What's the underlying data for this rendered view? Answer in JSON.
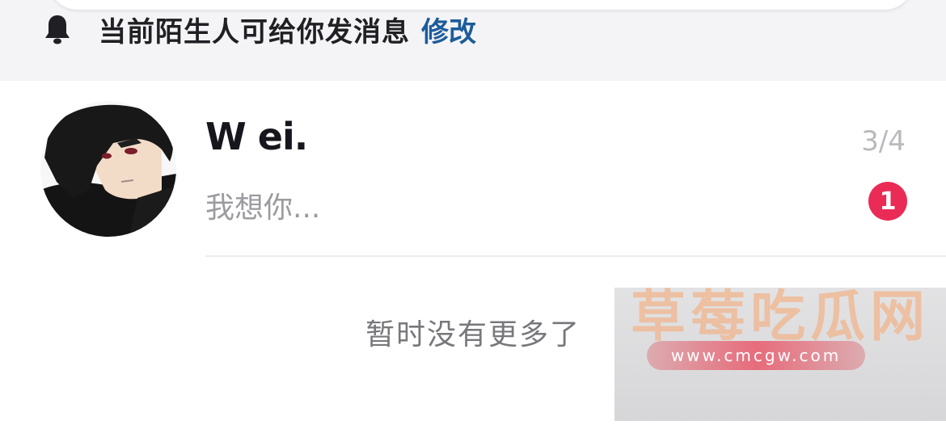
{
  "notice": {
    "icon": "bell-icon",
    "text": "当前陌生人可给你发消息",
    "action_label": "修改",
    "action_color": "#1d5c9b"
  },
  "conversation": {
    "avatar_icon": "anime-avatar",
    "name": "W ei.",
    "count": "3/4",
    "preview": "我想你...",
    "unread_badge": "1",
    "badge_color": "#ea2b56"
  },
  "empty_note": "暂时没有更多了",
  "watermark": {
    "title": "草莓吃瓜网",
    "url": "www.cmcgw.com"
  }
}
